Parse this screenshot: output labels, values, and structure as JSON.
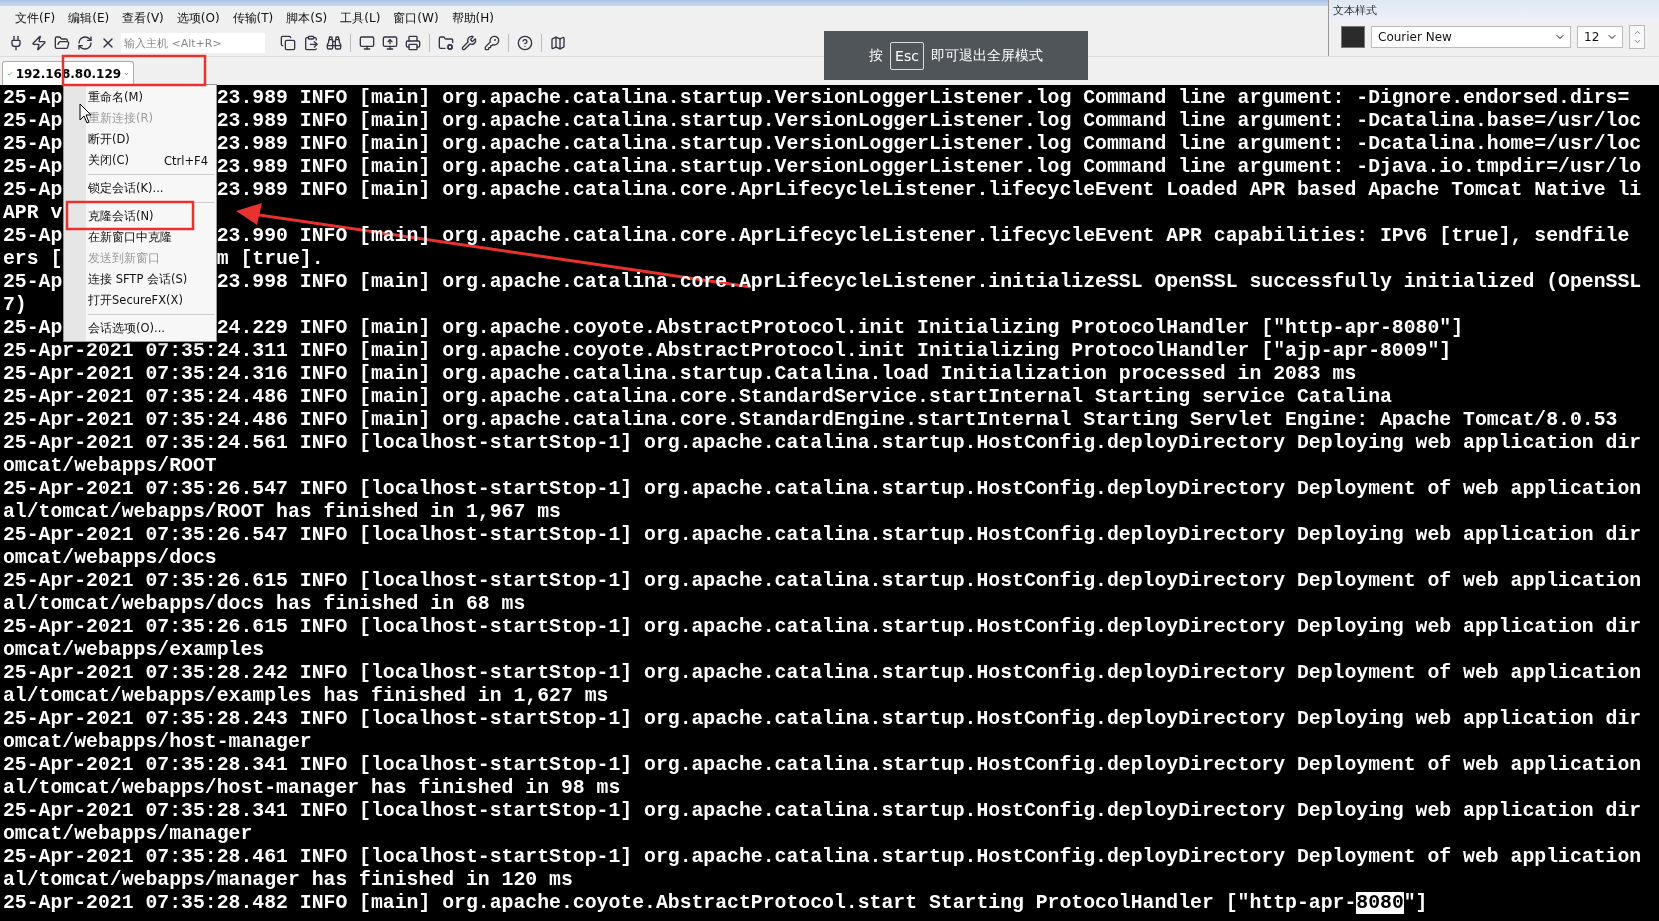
{
  "menu_bar": [
    "文件(F)",
    "编辑(E)",
    "查看(V)",
    "选项(O)",
    "传输(T)",
    "脚本(S)",
    "工具(L)",
    "窗口(W)",
    "帮助(H)"
  ],
  "toolbar": {
    "host_field": {
      "placeholder": "输入主机 <Alt+R>"
    }
  },
  "fullscreen_hint": {
    "prefix": "按",
    "key": "Esc",
    "message": "即可退出全屏模式"
  },
  "text_style_panel": {
    "title": "文本样式",
    "font": "Courier New",
    "size": "12"
  },
  "tab": {
    "label": "192.168.80.129",
    "connected": true
  },
  "context_menu": [
    {
      "label": "重命名(M)",
      "disabled": false
    },
    {
      "label": "重新连接(R)",
      "disabled": true
    },
    {
      "label": "断开(D)",
      "disabled": false
    },
    {
      "label": "关闭(C)",
      "shortcut": "Ctrl+F4",
      "disabled": false
    },
    {
      "kind": "separator"
    },
    {
      "label": "锁定会话(K)...",
      "disabled": false
    },
    {
      "kind": "separator"
    },
    {
      "label": "克隆会话(N)",
      "disabled": false
    },
    {
      "label": "在新窗口中克隆",
      "disabled": false
    },
    {
      "label": "发送到新窗口",
      "disabled": true
    },
    {
      "label": "连接 SFTP 会话(S)",
      "disabled": false
    },
    {
      "label": "打开SecureFX(X)",
      "disabled": false
    },
    {
      "kind": "separator"
    },
    {
      "label": "会话选项(O)...",
      "disabled": false
    }
  ],
  "terminal_lines": [
    {
      "left": "25-Ap",
      "right": "23.989 INFO [main] org.apache.catalina.startup.VersionLoggerListener.log Command line argument: -Dignore.endorsed.dirs="
    },
    {
      "left": "25-Ap",
      "right": "23.989 INFO [main] org.apache.catalina.startup.VersionLoggerListener.log Command line argument: -Dcatalina.base=/usr/loc"
    },
    {
      "left": "25-Ap",
      "right": "23.989 INFO [main] org.apache.catalina.startup.VersionLoggerListener.log Command line argument: -Dcatalina.home=/usr/loc"
    },
    {
      "left": "25-Ap",
      "right": "23.989 INFO [main] org.apache.catalina.startup.VersionLoggerListener.log Command line argument: -Djava.io.tmpdir=/usr/lo"
    },
    {
      "left": "25-Ap",
      "right": "23.989 INFO [main] org.apache.catalina.core.AprLifecycleListener.lifecycleEvent Loaded APR based Apache Tomcat Native li"
    },
    {
      "left": "APR v"
    },
    {
      "left": "25-Ap",
      "right": "23.990 INFO [main] org.apache.catalina.core.AprLifecycleListener.lifecycleEvent APR capabilities: IPv6 [true], sendfile"
    },
    {
      "left": "ers [",
      "right": "m [true]."
    },
    {
      "left": "25-Ap",
      "right": "23.998 INFO [main] org.apache.catalina.core.AprLifecycleListener.initializeSSL OpenSSL successfully initialized (OpenSSL"
    },
    {
      "text": "7)"
    },
    {
      "left": "25-Ap",
      "right": "24.229 INFO [main] org.apache.coyote.AbstractProtocol.init Initializing ProtocolHandler [\"http-apr-8080\"]"
    },
    {
      "text": "25-Apr-2021 07:35:24.311 INFO [main] org.apache.coyote.AbstractProtocol.init Initializing ProtocolHandler [\"ajp-apr-8009\"]"
    },
    {
      "text": "25-Apr-2021 07:35:24.316 INFO [main] org.apache.catalina.startup.Catalina.load Initialization processed in 2083 ms"
    },
    {
      "text": "25-Apr-2021 07:35:24.486 INFO [main] org.apache.catalina.core.StandardService.startInternal Starting service Catalina"
    },
    {
      "text": "25-Apr-2021 07:35:24.486 INFO [main] org.apache.catalina.core.StandardEngine.startInternal Starting Servlet Engine: Apache Tomcat/8.0.53"
    },
    {
      "text": "25-Apr-2021 07:35:24.561 INFO [localhost-startStop-1] org.apache.catalina.startup.HostConfig.deployDirectory Deploying web application dir"
    },
    {
      "text": "omcat/webapps/ROOT"
    },
    {
      "text": "25-Apr-2021 07:35:26.547 INFO [localhost-startStop-1] org.apache.catalina.startup.HostConfig.deployDirectory Deployment of web application"
    },
    {
      "text": "al/tomcat/webapps/ROOT has finished in 1,967 ms"
    },
    {
      "text": "25-Apr-2021 07:35:26.547 INFO [localhost-startStop-1] org.apache.catalina.startup.HostConfig.deployDirectory Deploying web application dir"
    },
    {
      "text": "omcat/webapps/docs"
    },
    {
      "text": "25-Apr-2021 07:35:26.615 INFO [localhost-startStop-1] org.apache.catalina.startup.HostConfig.deployDirectory Deployment of web application"
    },
    {
      "text": "al/tomcat/webapps/docs has finished in 68 ms"
    },
    {
      "text": "25-Apr-2021 07:35:26.615 INFO [localhost-startStop-1] org.apache.catalina.startup.HostConfig.deployDirectory Deploying web application dir"
    },
    {
      "text": "omcat/webapps/examples"
    },
    {
      "text": "25-Apr-2021 07:35:28.242 INFO [localhost-startStop-1] org.apache.catalina.startup.HostConfig.deployDirectory Deployment of web application"
    },
    {
      "text": "al/tomcat/webapps/examples has finished in 1,627 ms"
    },
    {
      "text": "25-Apr-2021 07:35:28.243 INFO [localhost-startStop-1] org.apache.catalina.startup.HostConfig.deployDirectory Deploying web application dir"
    },
    {
      "text": "omcat/webapps/host-manager"
    },
    {
      "text": "25-Apr-2021 07:35:28.341 INFO [localhost-startStop-1] org.apache.catalina.startup.HostConfig.deployDirectory Deployment of web application"
    },
    {
      "text": "al/tomcat/webapps/host-manager has finished in 98 ms"
    },
    {
      "text": "25-Apr-2021 07:35:28.341 INFO [localhost-startStop-1] org.apache.catalina.startup.HostConfig.deployDirectory Deploying web application dir"
    },
    {
      "text": "omcat/webapps/manager"
    },
    {
      "text": "25-Apr-2021 07:35:28.461 INFO [localhost-startStop-1] org.apache.catalina.startup.HostConfig.deployDirectory Deployment of web application"
    },
    {
      "text": "al/tomcat/webapps/manager has finished in 120 ms"
    },
    {
      "before": "25-Apr-2021 07:35:28.482 INFO [main] org.apache.coyote.AbstractProtocol.start Starting ProtocolHandler [\"http-apr-",
      "selected": "8080",
      "after": "\"]"
    }
  ]
}
